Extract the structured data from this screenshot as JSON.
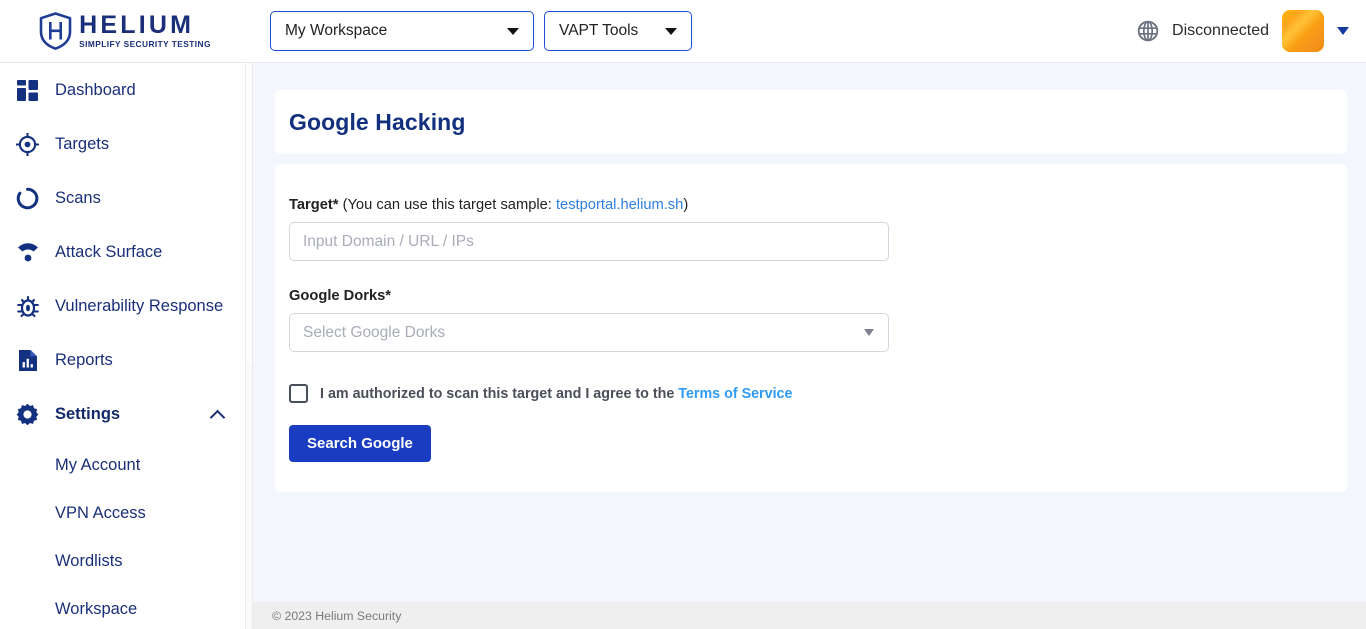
{
  "brand": {
    "name": "HELIUM",
    "tagline": "SIMPLIFY SECURITY TESTING",
    "logo_icon": "shield-icon",
    "color": "#1a2f7a"
  },
  "header": {
    "workspace_selector": {
      "label": "My Workspace",
      "icon": "chevron-down-icon"
    },
    "tools_selector": {
      "label": "VAPT Tools",
      "icon": "chevron-down-icon"
    },
    "connection": {
      "icon": "globe-icon",
      "status": "Disconnected"
    },
    "avatar": {
      "icon": "avatar",
      "color": "#ffa51e"
    },
    "account_caret": {
      "icon": "chevron-down-icon",
      "color": "#153a9e"
    }
  },
  "sidebar": {
    "items": [
      {
        "label": "Dashboard",
        "icon": "dashboard-grid-icon",
        "active": false
      },
      {
        "label": "Targets",
        "icon": "target-crosshair-icon",
        "active": false
      },
      {
        "label": "Scans",
        "icon": "scan-circle-icon",
        "active": false
      },
      {
        "label": "Attack Surface",
        "icon": "radar-signal-icon",
        "active": false
      },
      {
        "label": "Vulnerability Response",
        "icon": "bug-icon",
        "active": false
      },
      {
        "label": "Reports",
        "icon": "report-document-icon",
        "active": false
      },
      {
        "label": "Settings",
        "icon": "gear-icon",
        "active": true,
        "expand_icon": "chevron-up-icon"
      }
    ],
    "settings_subitems": [
      {
        "label": "My Account"
      },
      {
        "label": "VPN Access"
      },
      {
        "label": "Wordlists"
      },
      {
        "label": "Workspace"
      }
    ]
  },
  "main": {
    "page_title": "Google Hacking",
    "target_field": {
      "label": "Target*",
      "note_prefix": " (You can use this target sample: ",
      "sample_link": "testportal.helium.sh",
      "note_suffix": ")",
      "placeholder": "Input Domain / URL / IPs",
      "value": ""
    },
    "dorks_field": {
      "label": "Google Dorks*",
      "placeholder": "Select Google Dorks",
      "selected": "",
      "caret_icon": "chevron-down-icon"
    },
    "consent": {
      "checked": false,
      "text": "I am authorized to scan this target and I agree to the ",
      "link": "Terms of Service"
    },
    "submit_label": "Search Google",
    "accent_color": "#1a3cc0"
  },
  "footer": {
    "text": "© 2023 Helium Security"
  }
}
